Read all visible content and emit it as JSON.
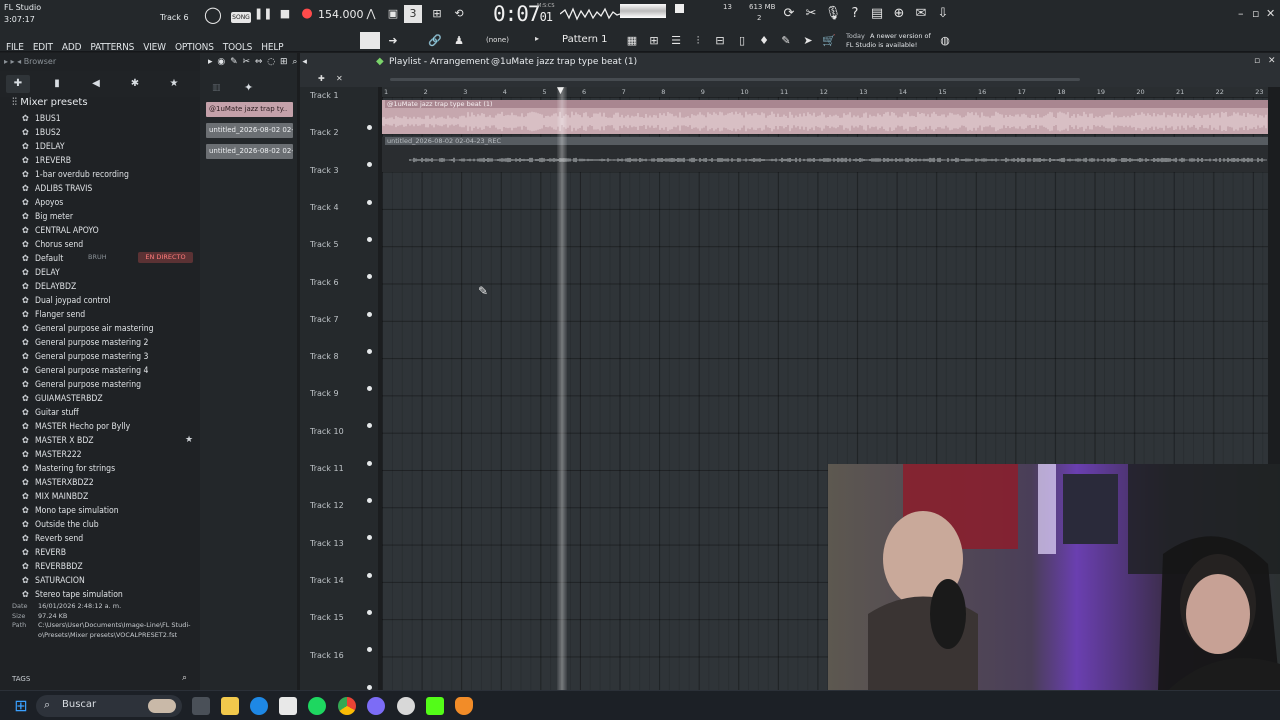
{
  "app": {
    "name": "FL Studio",
    "elapsed": "3:07:17",
    "channel": "Track 6",
    "song_mode": "SONG",
    "tempo": "154.000",
    "time_main": "0:07",
    "time_sub": "01",
    "time_unit": "M:S:CS",
    "cpu": "13",
    "memory": "613 MB",
    "voices": "2"
  },
  "menu": [
    "FILE",
    "EDIT",
    "ADD",
    "PATTERNS",
    "VIEW",
    "OPTIONS",
    "TOOLS",
    "HELP"
  ],
  "toolbar": {
    "pattern_select": "(none)",
    "pattern_name": "Pattern 1",
    "news_date": "Today",
    "news_text1": "A newer version of",
    "news_text2": "FL Studio is available!"
  },
  "browser": {
    "header": "Browser",
    "folder": "Mixer presets",
    "items": [
      "1BUS1",
      "1BUS2",
      "1DELAY",
      "1REVERB",
      "1-bar overdub recording",
      "ADLIBS TRAVIS",
      "Apoyos",
      "Big meter",
      "CENTRAL APOYO",
      "Chorus send",
      "Default",
      "DELAY",
      "DELAYBDZ",
      "Dual joypad control",
      "Flanger send",
      "General purpose air mastering",
      "General purpose mastering 2",
      "General purpose mastering 3",
      "General purpose mastering 4",
      "General purpose mastering",
      "GUIAMASTERBDZ",
      "Guitar stuff",
      "MASTER Hecho por Bylly",
      "MASTER X BDZ",
      "MASTER222",
      "Mastering for strings",
      "MASTERXBDZ2",
      "MIX MAINBDZ",
      "Mono tape simulation",
      "Outside the club",
      "Reverb send",
      "REVERB",
      "REVERBBDZ",
      "SATURACION",
      "Stereo tape simulation"
    ],
    "overlay_live": "EN DIRECTO",
    "overlay_user": "BRUH",
    "info": {
      "date_label": "Date",
      "date": "16/01/2026 2:48:12 a. m.",
      "size_label": "Size",
      "size": "97.24 KB",
      "path_label": "Path",
      "path1": "C:\\Users\\User\\Documents\\Image-Line\\FL Studi-",
      "path2": "o\\Presets\\Mixer presets\\VOCALPRESET2.fst"
    },
    "tags_label": "TAGS"
  },
  "picker": {
    "clips": [
      "@1uMate jazz trap ty..",
      "untitled_2026-08-02 02-..",
      "untitled_2026-08-02 02-.."
    ]
  },
  "playlist": {
    "title": "Playlist - Arrangement",
    "pattern": "@1uMate jazz trap type beat (1)",
    "bars": [
      "1",
      "2",
      "3",
      "4",
      "5",
      "6",
      "7",
      "8",
      "9",
      "10",
      "11",
      "12",
      "13",
      "14",
      "15",
      "16",
      "17",
      "18",
      "19",
      "20",
      "21",
      "22",
      "23"
    ],
    "tracks": [
      "Track 1",
      "Track 2",
      "Track 3",
      "Track 4",
      "Track 5",
      "Track 6",
      "Track 7",
      "Track 8",
      "Track 9",
      "Track 10",
      "Track 11",
      "Track 12",
      "Track 13",
      "Track 14",
      "Track 15",
      "Track 16"
    ],
    "clip1_label": "@1uMate jazz trap type beat (1)",
    "clip2_label": "untitled_2026-08-02 02-04-23_REC"
  },
  "taskbar": {
    "search_placeholder": "Buscar"
  },
  "colors": {
    "audio_clip": "#c6a7ae",
    "recording_clip": "#575c61",
    "accent_green": "#7bd46b"
  }
}
